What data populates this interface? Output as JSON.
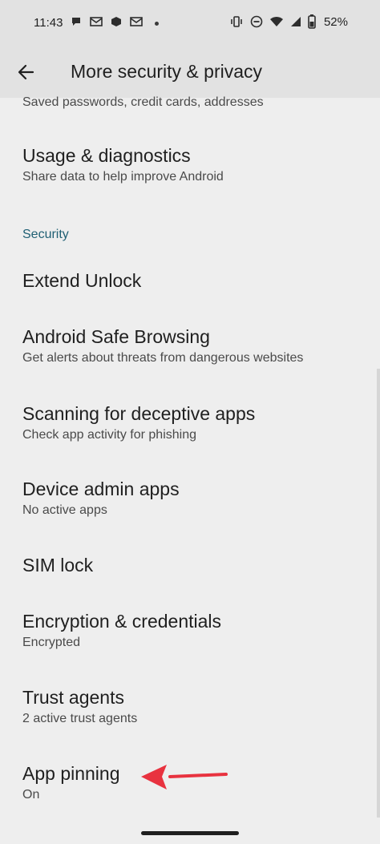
{
  "status_bar": {
    "time": "11:43",
    "battery_pct": "52%"
  },
  "header": {
    "title": "More security & privacy"
  },
  "partial_row_sub": "Saved passwords, credit cards, addresses",
  "rows_top": [
    {
      "title": "Usage & diagnostics",
      "subtitle": "Share data to help improve Android"
    }
  ],
  "section": {
    "label": "Security"
  },
  "security_rows": [
    {
      "title": "Extend Unlock",
      "subtitle": ""
    },
    {
      "title": "Android Safe Browsing",
      "subtitle": "Get alerts about threats from dangerous websites"
    },
    {
      "title": "Scanning for deceptive apps",
      "subtitle": "Check app activity for phishing"
    },
    {
      "title": "Device admin apps",
      "subtitle": "No active apps"
    },
    {
      "title": "SIM lock",
      "subtitle": ""
    },
    {
      "title": "Encryption & credentials",
      "subtitle": "Encrypted"
    },
    {
      "title": "Trust agents",
      "subtitle": "2 active trust agents"
    },
    {
      "title": "App pinning",
      "subtitle": "On"
    }
  ],
  "icons": {
    "back": "arrow-left-icon",
    "annotation": "red-arrow-icon"
  },
  "colors": {
    "section_accent": "#1f5f73",
    "annotation_arrow": "#e8323f"
  }
}
